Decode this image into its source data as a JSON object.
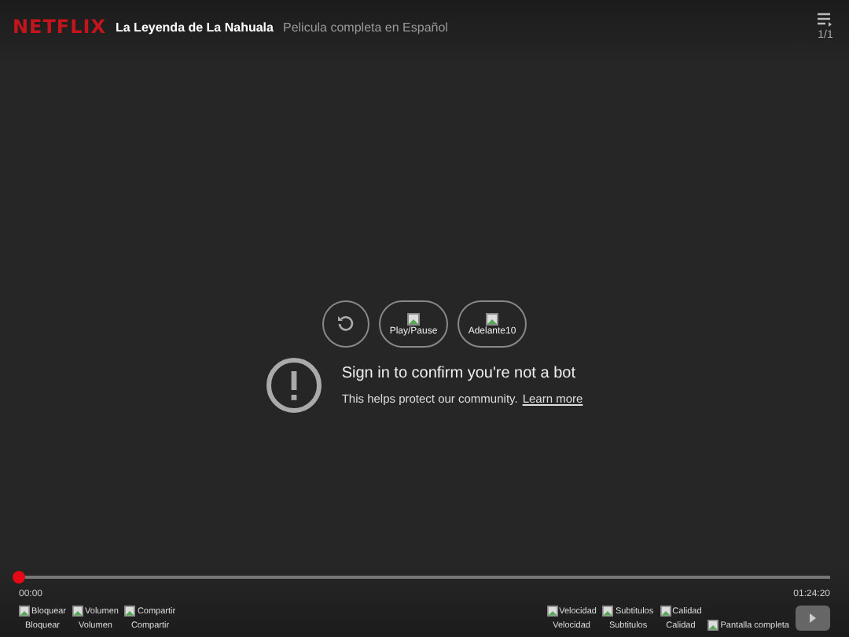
{
  "header": {
    "logo": "NETFLIX",
    "title": "La Leyenda de La Nahuala",
    "subtitle": "Pelicula completa en Español",
    "playlist_count": "1/1"
  },
  "controls": [
    {
      "kind": "replay"
    },
    {
      "kind": "image",
      "alt": "Play/Pause"
    },
    {
      "kind": "image",
      "alt": "Adelante10"
    }
  ],
  "message": {
    "heading": "Sign in to confirm you're not a bot",
    "body": "This helps protect our community.",
    "link": "Learn more"
  },
  "progress": {
    "level": 0,
    "current": "00:00",
    "duration": "01:24:20"
  },
  "left_buttons": [
    {
      "alt": "Bloquear",
      "label": "Bloquear"
    },
    {
      "alt": "Volumen",
      "label": "Volumen"
    },
    {
      "alt": "Compartir",
      "label": "Compartir"
    }
  ],
  "right_buttons": [
    {
      "alt": "Velocidad",
      "label": "Velocidad"
    },
    {
      "alt": "Subtitulos",
      "label": "Subtitulos"
    },
    {
      "alt": "Calidad",
      "label": "Calidad"
    },
    {
      "alt": "Pantalla completa"
    }
  ]
}
